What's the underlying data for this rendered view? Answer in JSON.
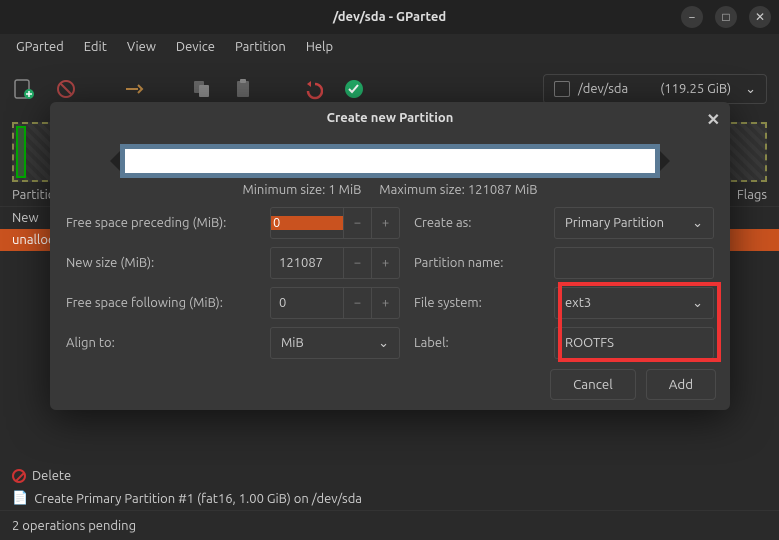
{
  "titlebar": {
    "title": "/dev/sda - GParted"
  },
  "menubar": {
    "items": [
      "GParted",
      "Edit",
      "View",
      "Device",
      "Partition",
      "Help"
    ]
  },
  "toolbar": {
    "device_name": "/dev/sda",
    "device_size": "(119.25 GiB)"
  },
  "table": {
    "header_partition": "Partition",
    "header_flags": "Flags",
    "rows": [
      {
        "name": "New"
      },
      {
        "name": "unallocated"
      }
    ]
  },
  "operations": {
    "op0": "Delete",
    "op1": "Create Primary Partition #1 (fat16, 1.00 GiB) on /dev/sda"
  },
  "status": {
    "text": "2 operations pending"
  },
  "dialog": {
    "title": "Create new Partition",
    "min_label": "Minimum size: 1 MiB",
    "max_label": "Maximum size: 121087 MiB",
    "labels": {
      "free_preceding": "Free space preceding (MiB):",
      "new_size": "New size (MiB):",
      "free_following": "Free space following (MiB):",
      "align_to": "Align to:",
      "create_as": "Create as:",
      "partition_name": "Partition name:",
      "file_system": "File system:",
      "label": "Label:"
    },
    "values": {
      "free_preceding": "0",
      "new_size": "121087",
      "free_following": "0",
      "align_to": "MiB",
      "create_as": "Primary Partition",
      "partition_name": "",
      "file_system": "ext3",
      "label": "ROOTFS"
    },
    "buttons": {
      "cancel": "Cancel",
      "add": "Add"
    }
  }
}
